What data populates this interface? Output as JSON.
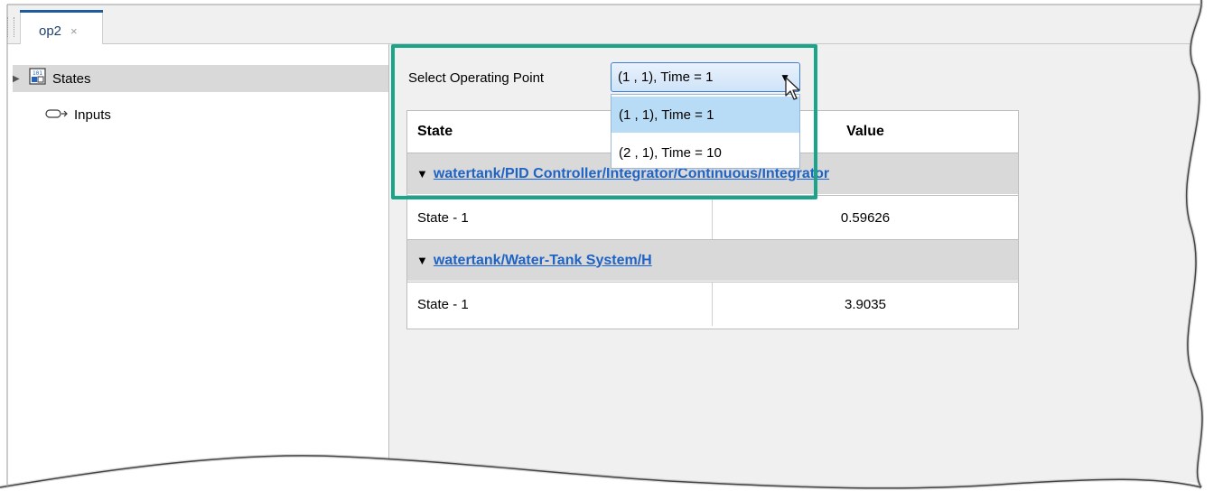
{
  "tab": {
    "label": "op2",
    "close": "×"
  },
  "tree": {
    "items": [
      {
        "label": "States",
        "expander": "▶"
      },
      {
        "label": "Inputs"
      }
    ]
  },
  "operating_point": {
    "label": "Select Operating Point",
    "selected": "(1 , 1), Time = 1",
    "arrow": "▼",
    "options": [
      "(1 , 1), Time = 1",
      "(2 , 1), Time = 10"
    ]
  },
  "table": {
    "headers": {
      "state": "State",
      "value": "Value"
    },
    "groups": [
      {
        "name": "watertank/PID Controller/Integrator/Continuous/Integrator",
        "rows": [
          {
            "state": "State - 1",
            "value": "0.59626"
          }
        ]
      },
      {
        "name": "watertank/Water-Tank System/H",
        "rows": [
          {
            "state": "State - 1",
            "value": "3.9035"
          }
        ]
      }
    ],
    "triangle": "▼"
  },
  "colors": {
    "highlight": "#1aa58a",
    "link": "#1e63c6",
    "tab_accent": "#1d5c9c"
  }
}
